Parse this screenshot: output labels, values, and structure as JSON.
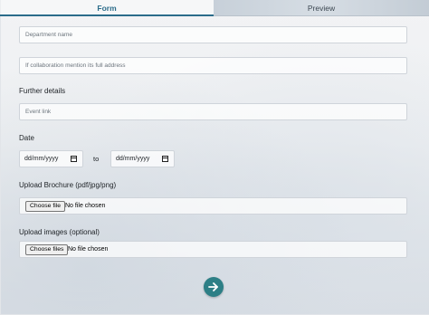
{
  "tabs": {
    "form": "Form",
    "preview": "Preview"
  },
  "form": {
    "department_placeholder": "Department name",
    "collaboration_placeholder": "If collaboration mention its full address",
    "further_details_label": "Further details",
    "event_link_placeholder": "Event link",
    "date_label": "Date",
    "date_from_value": "dd/mm/yyyy",
    "date_to_separator": "to",
    "date_to_value": "dd/mm/yyyy",
    "brochure_label": "Upload Brochure (pdf/jpg/png)",
    "brochure_button": "Choose file",
    "brochure_status": "No file chosen",
    "images_label": "Upload images (optional)",
    "images_button": "Choose files",
    "images_status": "No file chosen"
  },
  "submit": {
    "icon": "arrow-right-icon",
    "color": "#2d7f86"
  },
  "colors": {
    "accent": "#2b6c8a"
  }
}
